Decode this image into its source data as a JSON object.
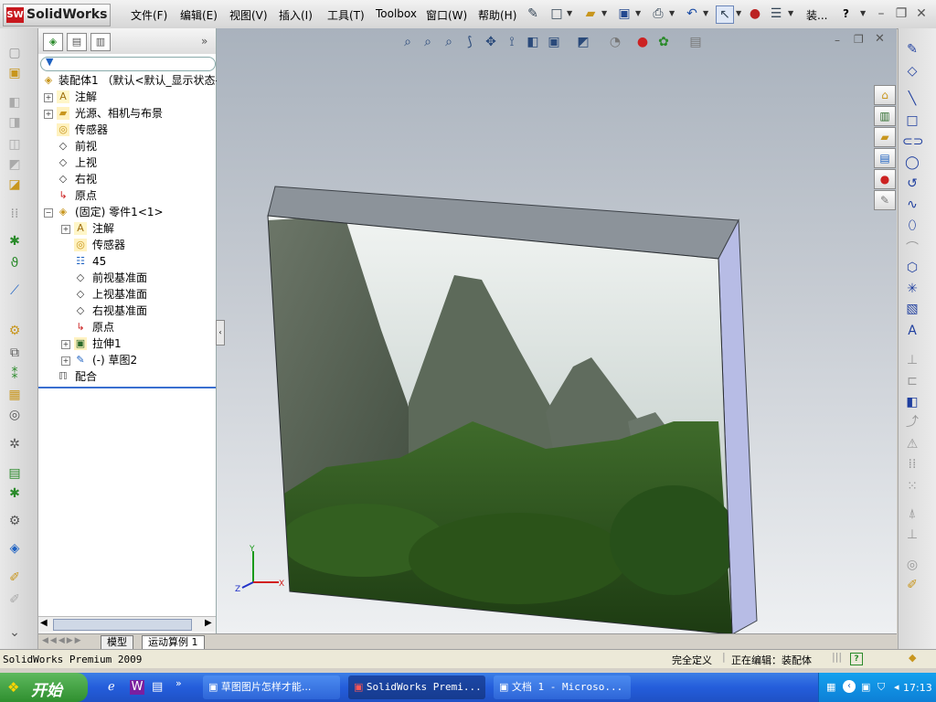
{
  "app": {
    "logo_badge": "SW",
    "name": "SolidWorks"
  },
  "menu": {
    "file": "文件(F)",
    "edit": "编辑(E)",
    "view": "视图(V)",
    "insert": "插入(I)",
    "tools": "工具(T)",
    "toolbox": "Toolbox",
    "window": "窗口(W)",
    "help": "帮助(H)"
  },
  "toolbar": {
    "doc_title": "装...",
    "help_mark": "?"
  },
  "tree": {
    "root": "装配体1 （默认<默认_显示状态-",
    "items": [
      {
        "label": "注解",
        "icon": "annotation-icon"
      },
      {
        "label": "光源、相机与布景",
        "icon": "lights-folder-icon"
      },
      {
        "label": "传感器",
        "icon": "sensor-icon"
      },
      {
        "label": "前视",
        "icon": "plane-icon"
      },
      {
        "label": "上视",
        "icon": "plane-icon"
      },
      {
        "label": "右视",
        "icon": "plane-icon"
      },
      {
        "label": "原点",
        "icon": "origin-icon"
      },
      {
        "label": "(固定) 零件1<1>",
        "icon": "part-icon"
      },
      {
        "label": "注解",
        "icon": "annotation-icon"
      },
      {
        "label": "传感器",
        "icon": "sensor-icon"
      },
      {
        "label": "45",
        "icon": "material-icon"
      },
      {
        "label": "前视基准面",
        "icon": "plane-icon"
      },
      {
        "label": "上视基准面",
        "icon": "plane-icon"
      },
      {
        "label": "右视基准面",
        "icon": "plane-icon"
      },
      {
        "label": "原点",
        "icon": "origin-icon"
      },
      {
        "label": "拉伸1",
        "icon": "extrude-icon"
      },
      {
        "label": "(-) 草图2",
        "icon": "sketch-icon"
      },
      {
        "label": "配合",
        "icon": "mates-icon"
      }
    ]
  },
  "tabs": {
    "model": "模型",
    "motion": "运动算例 1"
  },
  "status": {
    "version": "SolidWorks Premium 2009",
    "defined": "完全定义",
    "editing": "正在编辑：装配体",
    "help": "?"
  },
  "taskbar": {
    "start": "开始",
    "items": [
      "草图图片怎样才能...",
      "SolidWorks Premi...",
      "文档 1 - Microso..."
    ],
    "clock": "17:13"
  },
  "triad": {
    "x": "X",
    "y": "Y",
    "z": "Z"
  }
}
